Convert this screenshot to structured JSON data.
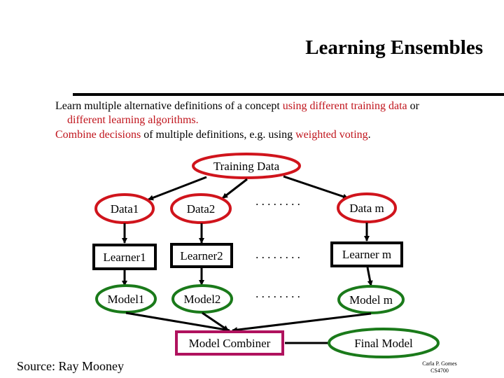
{
  "slide": {
    "title": "Learning Ensembles",
    "intro": {
      "line1_black": "Learn multiple alternative definitions of a concept ",
      "line1_red": "using different training data",
      "line1_tail": " or",
      "line2_red": "different learning algorithms.",
      "line3_red1": "Combine decisions",
      "line3_black": " of multiple definitions, e.g. using ",
      "line3_red2": "weighted voting",
      "line3_tail": "."
    },
    "source": "Source: Ray Mooney",
    "credit_line1": "Carla P. Gomes",
    "credit_line2": "CS4700"
  },
  "colors": {
    "data_outline": "#d0141c",
    "model_outline": "#1a7a1a",
    "combiner_outline": "#b0125e",
    "highlight_text": "#c0141c"
  },
  "diagram": {
    "training_data": "Training Data",
    "data_nodes": [
      "Data1",
      "Data2",
      "Data m"
    ],
    "learner_nodes": [
      "Learner1",
      "Learner2",
      "Learner m"
    ],
    "model_nodes": [
      "Model1",
      "Model2",
      "Model m"
    ],
    "ellipsis": ". . . . . . . .",
    "combiner": "Model Combiner",
    "final_model": "Final Model"
  }
}
